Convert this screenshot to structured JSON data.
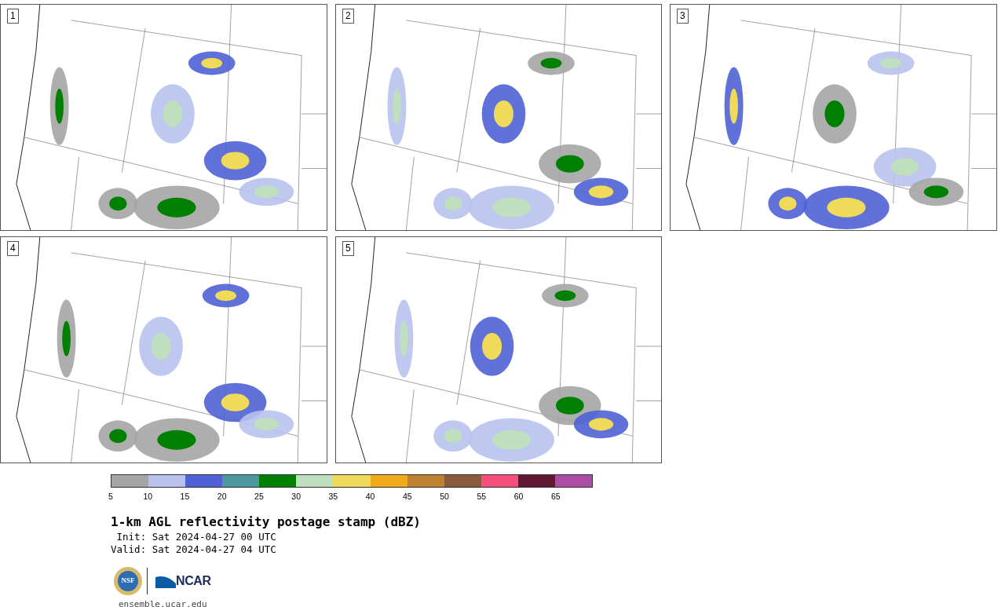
{
  "panels": [
    {
      "label": "1"
    },
    {
      "label": "2"
    },
    {
      "label": "3"
    },
    {
      "label": "4"
    },
    {
      "label": "5"
    }
  ],
  "colorbar": {
    "bins": [
      {
        "color": "#a5a5a5"
      },
      {
        "color": "#b8c2ec"
      },
      {
        "color": "#5062d6"
      },
      {
        "color": "#4d979e"
      },
      {
        "color": "#008000"
      },
      {
        "color": "#bfdfbf"
      },
      {
        "color": "#f0da5a"
      },
      {
        "color": "#f0ac18"
      },
      {
        "color": "#bc8232"
      },
      {
        "color": "#8b5a3c"
      },
      {
        "color": "#f5507c"
      },
      {
        "color": "#601834"
      },
      {
        "color": "#ac4ca4"
      }
    ],
    "ticks": [
      "5",
      "10",
      "15",
      "20",
      "25",
      "30",
      "35",
      "40",
      "45",
      "50",
      "55",
      "60",
      "65"
    ]
  },
  "title": "1-km AGL reflectivity postage stamp (dBZ)",
  "init": " Init: Sat 2024-04-27 00 UTC",
  "valid": "Valid: Sat 2024-04-27 04 UTC",
  "logos": {
    "seal": "NSF",
    "wordmark": "NCAR"
  },
  "url": "ensemble.ucar.edu"
}
